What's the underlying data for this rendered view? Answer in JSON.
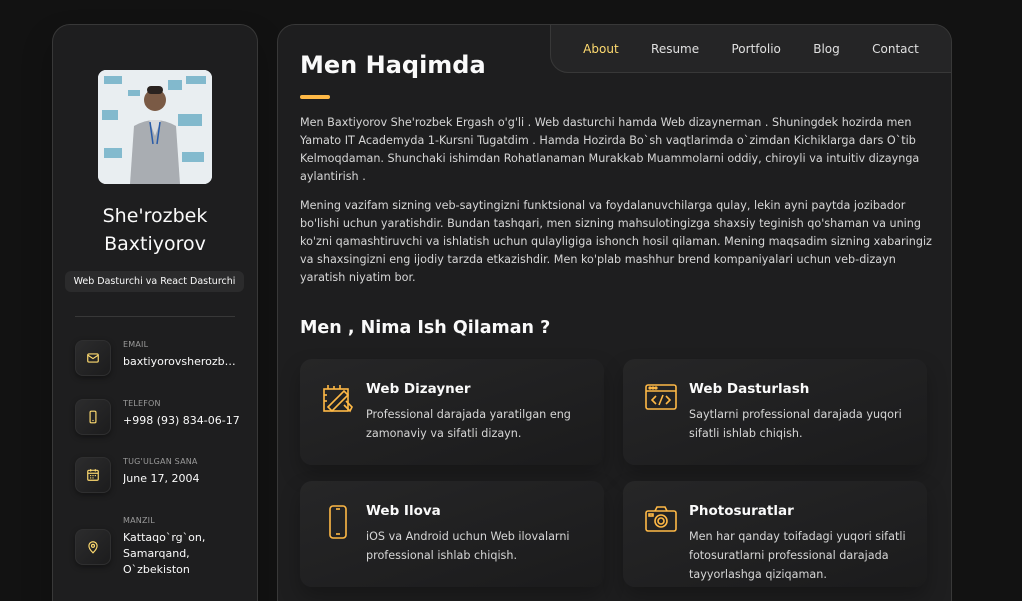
{
  "profile": {
    "name": "She'rozbek Baxtiyorov",
    "title": "Web Dasturchi va React Dasturchi",
    "contacts": [
      {
        "label": "EMAIL",
        "value": "baxtiyorovsherozbek@gmail.com",
        "icon": "mail-icon"
      },
      {
        "label": "TELEFON",
        "value": "+998 (93) 834-06-17",
        "icon": "phone-icon"
      },
      {
        "label": "TUG'ULGAN SANA",
        "value": "June 17, 2004",
        "icon": "calendar-icon"
      },
      {
        "label": "MANZIL",
        "value": "Kattaqo`rg`on, Samarqand, O`zbekiston",
        "icon": "location-icon"
      }
    ]
  },
  "nav": {
    "items": [
      "About",
      "Resume",
      "Portfolio",
      "Blog",
      "Contact"
    ],
    "active": "About"
  },
  "about": {
    "title": "Men Haqimda",
    "paragraphs": [
      "Men Baxtiyorov She'rozbek Ergash o'g'li . Web dasturchi hamda Web dizaynerman . Shuningdek hozirda men Yamato IT Academyda 1-Kursni Tugatdim . Hamda Hozirda Bo`sh vaqtlarimda o`zimdan Kichiklarga dars O`tib Kelmoqdaman. Shunchaki ishimdan Rohatlanaman Murakkab Muammolarni oddiy, chiroyli va intuitiv dizaynga aylantirish .",
      "Mening vazifam sizning veb-saytingizni funktsional va foydalanuvchilarga qulay, lekin ayni paytda jozibador bo'lishi uchun yaratishdir. Bundan tashqari, men sizning mahsulotingizga shaxsiy teginish qo'shaman va uning ko'zni qamashtiruvchi va ishlatish uchun qulayligiga ishonch hosil qilaman. Mening maqsadim sizning xabaringiz va shaxsingizni eng ijodiy tarzda etkazishdir. Men ko'plab mashhur brend kompaniyalari uchun veb-dizayn yaratish niyatim bor."
    ]
  },
  "services": {
    "title": "Men , Nima Ish Qilaman ?",
    "items": [
      {
        "title": "Web Dizayner",
        "desc": "Professional darajada yaratilgan eng zamonaviy va sifatli dizayn.",
        "icon": "design-icon"
      },
      {
        "title": "Web Dasturlash",
        "desc": "Saytlarni professional darajada yuqori sifatli ishlab chiqish.",
        "icon": "code-icon"
      },
      {
        "title": "Web Ilova",
        "desc": "iOS va Android uchun Web ilovalarni professional ishlab chiqish.",
        "icon": "mobile-icon"
      },
      {
        "title": "Photosuratlar",
        "desc": "Men har qanday toifadagi yuqori sifatli fotosuratlarni professional darajada tayyorlashga qiziqaman.",
        "icon": "camera-icon"
      }
    ]
  },
  "colors": {
    "accent": "#ffdb70",
    "accent_bar": "#ffb946",
    "background": "#121212",
    "card": "#1e1e1f"
  }
}
